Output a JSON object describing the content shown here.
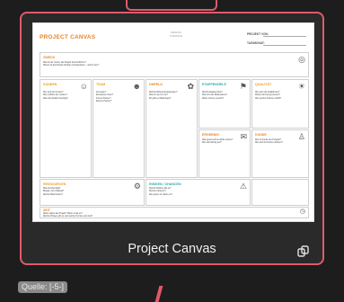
{
  "caption": "Project Canvas",
  "source_label": "Quelle: [-5-]",
  "icons": {
    "copy": "copy-icon"
  },
  "doc": {
    "title": "PROJECT CANVAS",
    "logo_text": "DESIGN THINKING",
    "header_fields": [
      "PROJEKT VON:",
      "TAG/MONAT:"
    ],
    "sections": {
      "zweck": {
        "label": "ZWECK",
        "text": "Was ist der Grund, das Projekt durchzuführen?\nWarum ist das Projekt wichtig und bedeutsam – und für wen?"
      },
      "kunden": {
        "label": "KUNDEN",
        "text": "Wer sind die Kunden?\nWer profitiert am meisten?\nWas wird wirklich benötigt?"
      },
      "team": {
        "label": "TEAM",
        "text": "Kernteam?\nErweitertes Team?\nInterne Partner?\nExterne Partner?"
      },
      "umfeld": {
        "label": "UMFELD",
        "text": "Welche Rahmenbedingungen?\nWas ist neu für uns?\nWo gibt es Widerstand?"
      },
      "etappenziele": {
        "label": "ETAPPENZIELE",
        "text": "Welche Etappenziele?\nWas sind die Meilensteine?\nWann sind sie erreicht?"
      },
      "qualitaet": {
        "label": "QUALITÄT",
        "text": "Wie sieht die Qualität aus?\nWoran wird sie gemessen?\nWie werden Kriterien erfüllt?"
      },
      "ressourcen": {
        "label": "RESSOURCEN",
        "text": "Was wird benötigt?\nBudget, Zeit, Material?\nWelche Mittel fehlen?"
      },
      "risiken": {
        "label": "RISIKEN / CHANCEN",
        "text": "Welche Risiken gibt es?\nWelche Chancen?\nWie gehen wir damit um?"
      },
      "ergebnis": {
        "label": "ERGEBNIS",
        "text": "Was genau soll am Ende stehen?\nWie sieht Erfolg aus?"
      },
      "kunde2": {
        "label": "KUNDE",
        "text": "Wer ist Kunde des Projekts?\nWie wird der Nutzen definiert?"
      },
      "zeit": {
        "label": "ZEIT",
        "text": "Wann startet das Projekt? Wann endet es?\nWelche Phasen gibt es und welche Termine sind fest?"
      }
    },
    "footer_left": "Canvas unter Creative Commons Lizenz",
    "footer_right": "Quelle: Project Canvas Vorlage"
  }
}
